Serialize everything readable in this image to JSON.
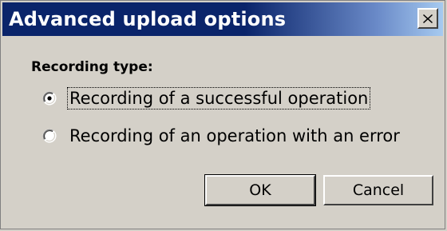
{
  "window": {
    "title": "Advanced upload options",
    "close_icon": "close-icon"
  },
  "recording_type": {
    "label": "Recording type:",
    "options": [
      {
        "label": "Recording of a successful operation",
        "selected": true
      },
      {
        "label": "Recording of an operation with an error",
        "selected": false
      }
    ]
  },
  "buttons": {
    "ok_label": "OK",
    "cancel_label": "Cancel"
  },
  "colors": {
    "titlebar_start": "#0a246a",
    "titlebar_end": "#a6caf0",
    "face": "#d4d0c8"
  }
}
